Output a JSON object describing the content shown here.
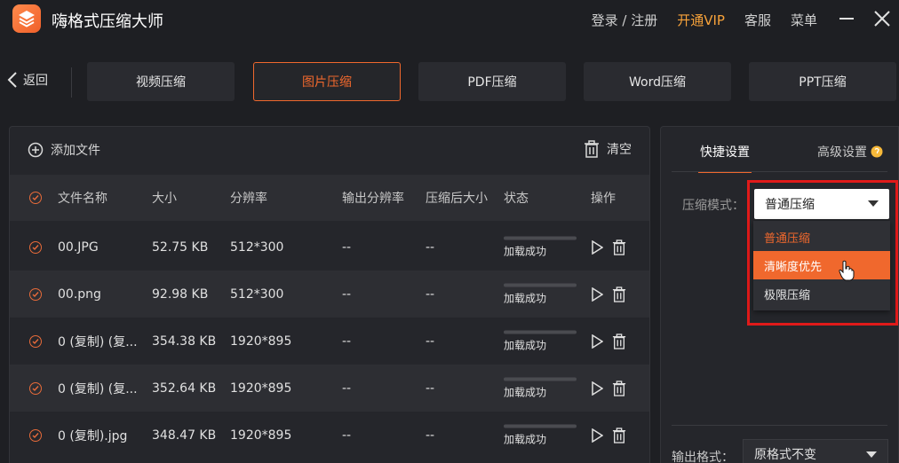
{
  "app": {
    "title": "嗨格式压缩大师",
    "login_register": "登录 / 注册",
    "vip": "开通VIP",
    "service": "客服",
    "menu": "菜单",
    "accent": "#f0682d",
    "vip_color": "#f7a23a"
  },
  "nav": {
    "back": "返回",
    "tabs": [
      {
        "label": "视频压缩"
      },
      {
        "label": "图片压缩"
      },
      {
        "label": "PDF压缩"
      },
      {
        "label": "Word压缩"
      },
      {
        "label": "PPT压缩"
      }
    ],
    "active_tab": "图片压缩"
  },
  "toolbar": {
    "add_file": "添加文件",
    "clear": "清空"
  },
  "table": {
    "headers": [
      "文件名称",
      "大小",
      "分辨率",
      "输出分辨率",
      "压缩后大小",
      "状态",
      "操作"
    ],
    "rows": [
      {
        "name": "00.JPG",
        "size": "52.75 KB",
        "res": "512*300",
        "out_res": "--",
        "out_size": "--",
        "status": "加载成功",
        "progress": 0
      },
      {
        "name": "00.png",
        "size": "92.98 KB",
        "res": "512*300",
        "out_res": "--",
        "out_size": "--",
        "status": "加载成功",
        "progress": 0
      },
      {
        "name": "0 (复制) (复...",
        "size": "354.38 KB",
        "res": "1920*895",
        "out_res": "--",
        "out_size": "--",
        "status": "加载成功",
        "progress": 0
      },
      {
        "name": "0 (复制) (复...",
        "size": "352.64 KB",
        "res": "1920*895",
        "out_res": "--",
        "out_size": "--",
        "status": "加载成功",
        "progress": 0
      },
      {
        "name": "0 (复制).jpg",
        "size": "348.47 KB",
        "res": "1920*895",
        "out_res": "--",
        "out_size": "--",
        "status": "加载成功",
        "progress": 0
      }
    ]
  },
  "settings": {
    "tab_quick": "快捷设置",
    "tab_advanced": "高级设置",
    "mode_label": "压缩模式：",
    "mode_selected": "普通压缩",
    "mode_options": [
      "普通压缩",
      "清晰度优先",
      "极限压缩"
    ],
    "hovered_option": "清晰度优先",
    "format_label": "输出格式：",
    "format_selected": "原格式不变",
    "highlight_color": "#e01a1a"
  }
}
